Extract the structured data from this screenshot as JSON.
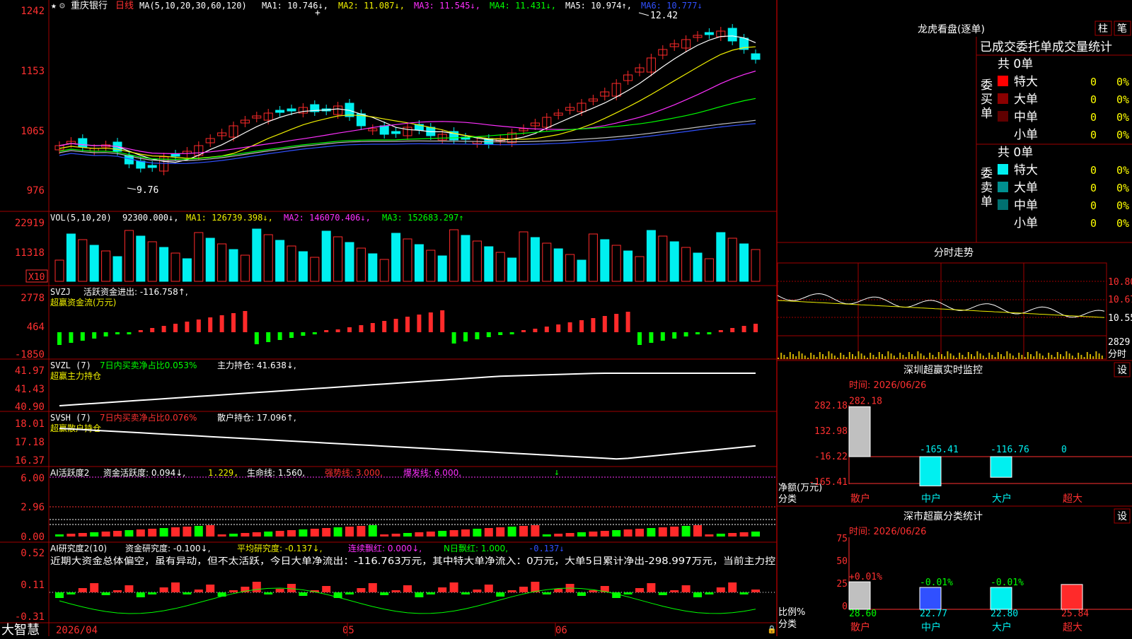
{
  "colors": {
    "up": "#ff2a2a",
    "down": "#00f0f0",
    "grid": "#a00000",
    "white": "#ffffff",
    "yellow": "#f0f000",
    "magenta": "#ff30ff",
    "green": "#00ff00",
    "blue": "#3050ff",
    "gray": "#c0c0c0",
    "teal": "#008080",
    "darkred": "#8b0000"
  },
  "header": {
    "stock_name": "重庆银行",
    "period": "日线",
    "ma_title": "MA(5,10,20,30,60,120)",
    "ma1": "MA1: 10.746↓,",
    "ma2": "MA2: 11.087↓,",
    "ma3": "MA3: 11.545↓,",
    "ma4": "MA4: 11.431↓,",
    "ma5": "MA5: 10.974↑,",
    "ma6": "MA6: 10.777↓"
  },
  "price_axis": [
    "1242",
    "1153",
    "1065",
    "976"
  ],
  "high_label": "12.42",
  "low_label": "9.76",
  "vol": {
    "title": "VOL(5,10,20)",
    "value": "92300.000↓,",
    "ma1": "MA1: 126739.398↓,",
    "ma2": "MA2: 146070.406↓,",
    "ma3": "MA3: 152683.297↑",
    "axis": [
      "22919",
      "11318"
    ],
    "unit": "X10"
  },
  "svzj": {
    "title": "SVZJ",
    "text": "活跃资金进出: -116.758↑,",
    "sub": "超赢资金流(万元)",
    "axis": [
      "2778",
      "464",
      "-1850"
    ]
  },
  "svzl": {
    "title": "SVZL (7)",
    "text1": "7日内买卖净占比0.053%",
    "text2": "主力持仓: 41.638↓,",
    "sub": "超赢主力持仓",
    "axis": [
      "41.97",
      "41.43",
      "40.90"
    ]
  },
  "svsh": {
    "title": "SVSH (7)",
    "text1": "7日内买卖净占比0.076%",
    "text2": "散户持仓: 17.096↑,",
    "sub": "超赢散户持仓",
    "axis": [
      "18.01",
      "17.18",
      "16.37"
    ]
  },
  "ai1": {
    "title": "AI活跃度2",
    "t1": "资金活跃度: 0.094↓,",
    "t2": "1.229,",
    "t3": "生命线: 1.560,",
    "t4": "强势线: 3.000,",
    "t5": "爆发线: 6.000,",
    "axis": [
      "6.00",
      "2.96",
      "0.00"
    ]
  },
  "ai2": {
    "title": "AI研究度2(10)",
    "t1": "资金研究度: -0.100↓,",
    "t2": "平均研究度: -0.137↓,",
    "t3": "连续飘红: 0.000↓,",
    "t4": "N日飘红: 1.000,",
    "t5": "-0.137↓",
    "comment": "近期大资金总体偏空，虽有异动，但不太活跃，今日大单净流出：-116.763万元，其中特大单净流入：0万元，大单5日累计净出-298.997万元，当前主力控",
    "axis": [
      "0.52",
      "0.11",
      "-0.31"
    ]
  },
  "bottom": {
    "brand": "大智慧",
    "date": "2026/04",
    "m5": "05",
    "m6": "06"
  },
  "right": {
    "dragon_title": "龙虎看盘(逐单)",
    "btn_zhu": "柱",
    "btn_bi": "笔",
    "tab_header": "已成交委托单成交量统计",
    "buy": {
      "side": "委买单",
      "total": "共 0单",
      "rows": [
        {
          "label": "特大",
          "value": "0",
          "pct": "0%",
          "color": "#ff0000"
        },
        {
          "label": "大单",
          "value": "0",
          "pct": "0%",
          "color": "#8b0000"
        },
        {
          "label": "中单",
          "value": "0",
          "pct": "0%",
          "color": "#600000"
        },
        {
          "label": "小单",
          "value": "0",
          "pct": "0%",
          "color": ""
        }
      ]
    },
    "sell": {
      "side": "委卖单",
      "total": "共 0单",
      "rows": [
        {
          "label": "特大",
          "value": "0",
          "pct": "0%",
          "color": "#00f0f0"
        },
        {
          "label": "大单",
          "value": "0",
          "pct": "0%",
          "color": "#009090"
        },
        {
          "label": "中单",
          "value": "0",
          "pct": "0%",
          "color": "#007070"
        },
        {
          "label": "小单",
          "value": "0",
          "pct": "0%",
          "color": ""
        }
      ]
    },
    "intraday": {
      "title": "分时走势",
      "axis": [
        "10.80",
        "10.67",
        "10.55"
      ],
      "vol_label": "2829",
      "unit": "分时"
    },
    "monitor": {
      "title": "深圳超赢实时监控",
      "set": "设",
      "date": "时间: 2026/06/26",
      "axis": [
        "282.18",
        "132.98",
        "-16.22",
        "-165.41"
      ],
      "ylabel": "净额(万元)",
      "xlabel": "分类",
      "cats": [
        "散户",
        "中户",
        "大户",
        "超大"
      ],
      "values": [
        "282.18",
        "-165.41",
        "-116.76",
        "0"
      ]
    },
    "stats": {
      "title": "深市超赢分类统计",
      "set": "设",
      "date": "时间: 2026/06/26",
      "axis": [
        "75",
        "50",
        "25",
        "0"
      ],
      "ylabel": "比例%",
      "xlabel": "分类",
      "cats": [
        "散户",
        "中户",
        "大户",
        "超大"
      ],
      "top": [
        "+0.01%",
        "-0.01%",
        "-0.01%",
        ""
      ],
      "values": [
        "28.60",
        "22.77",
        "22.80",
        "25.84"
      ]
    }
  }
}
